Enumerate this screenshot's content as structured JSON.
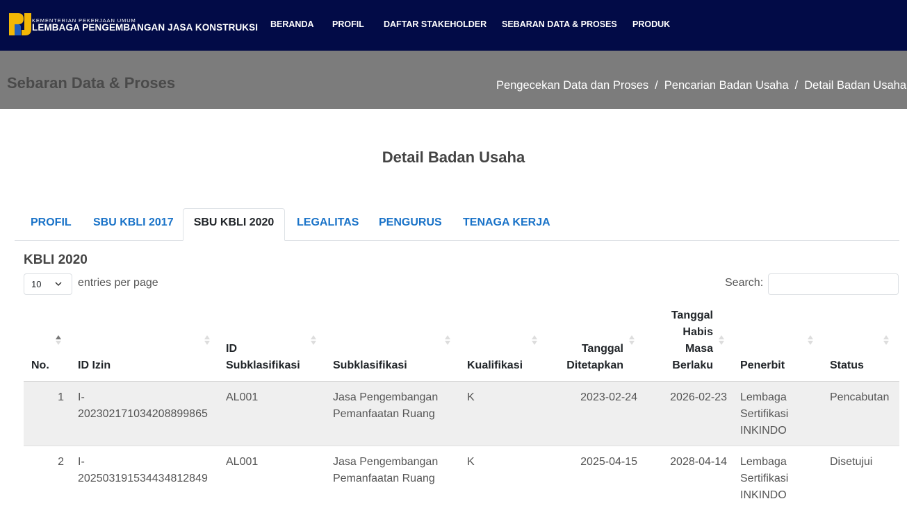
{
  "nav": {
    "brand_small": "KEMENTERIAN PEKERJAAN UMUM",
    "brand_big": "LEMBAGA PENGEMBANGAN JASA KONSTRUKSI",
    "links": [
      "BERANDA",
      "PROFIL",
      "DAFTAR STAKEHOLDER",
      "SEBARAN DATA & PROSES",
      "PRODUK"
    ]
  },
  "header": {
    "title": "Sebaran Data & Proses",
    "breadcrumb": [
      "Pengecekan Data dan Proses",
      "Pencarian Badan Usaha",
      "Detail Badan Usaha"
    ],
    "separator": "/"
  },
  "section_title": "Detail Badan Usaha",
  "tabs": [
    "PROFIL",
    "SBU KBLI 2017",
    "SBU KBLI 2020",
    "LEGALITAS",
    "PENGURUS",
    "TENAGA KERJA"
  ],
  "active_tab": "SBU KBLI 2020",
  "table": {
    "title": "KBLI 2020",
    "entries_value": "10",
    "entries_label": "entries per page",
    "search_label": "Search:",
    "search_value": "",
    "columns": [
      {
        "label": "No.",
        "lines": [
          "No."
        ]
      },
      {
        "label": "ID Izin",
        "lines": [
          "ID Izin"
        ]
      },
      {
        "label": "ID Subklasifikasi",
        "lines": [
          "ID",
          "Subklasifikasi"
        ]
      },
      {
        "label": "Subklasifikasi",
        "lines": [
          "Subklasifikasi"
        ]
      },
      {
        "label": "Kualifikasi",
        "lines": [
          "Kualifikasi"
        ]
      },
      {
        "label": "Tanggal Ditetapkan",
        "lines": [
          "Tanggal",
          "Ditetapkan"
        ]
      },
      {
        "label": "Tanggal Habis Masa Berlaku",
        "lines": [
          "Tanggal",
          "Habis",
          "Masa",
          "Berlaku"
        ]
      },
      {
        "label": "Penerbit",
        "lines": [
          "Penerbit"
        ]
      },
      {
        "label": "Status",
        "lines": [
          "Status"
        ]
      }
    ],
    "sorted_column": "No.",
    "rows": [
      {
        "no": "1",
        "id_izin": [
          "I-",
          "20230217103420889986​5"
        ],
        "id_sub": "AL001",
        "sub": [
          "Jasa Pengembangan",
          "Pemanfaatan Ruang"
        ],
        "kual": "K",
        "tgl_tetap": "2023-02-24",
        "tgl_habis": "2026-02-23",
        "penerbit": [
          "Lembaga",
          "Sertifikasi",
          "INKINDO"
        ],
        "status": "Pencabutan"
      },
      {
        "no": "2",
        "id_izin": [
          "I-",
          "202503191534434812849"
        ],
        "id_sub": "AL001",
        "sub": [
          "Jasa Pengembangan",
          "Pemanfaatan Ruang"
        ],
        "kual": "K",
        "tgl_tetap": "2025-04-15",
        "tgl_habis": "2028-04-14",
        "penerbit": [
          "Lembaga",
          "Sertifikasi",
          "INKINDO"
        ],
        "status": "Disetujui"
      }
    ]
  },
  "colors": {
    "navbar": "#020b47",
    "header_band": "#7c7c7c",
    "tab_link": "#1a73c8",
    "logo_yellow": "#f2b705",
    "logo_blue": "#1f5fbf"
  },
  "icons": [
    "pu-logo-icon",
    "chevron-down-icon",
    "sort-arrows-icon"
  ]
}
